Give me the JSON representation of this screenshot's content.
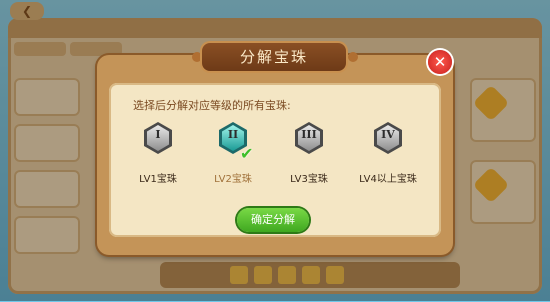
{
  "dialog": {
    "title": "分解宝珠",
    "prompt": "选择后分解对应等级的所有宝珠:",
    "close_glyph": "✕",
    "confirm_label": "确定分解"
  },
  "gems": [
    {
      "numeral": "I",
      "label": "LV1宝珠",
      "selected": false
    },
    {
      "numeral": "II",
      "label": "LV2宝珠",
      "selected": true
    },
    {
      "numeral": "III",
      "label": "LV3宝珠",
      "selected": false
    },
    {
      "numeral": "IV",
      "label": "LV4以上宝珠",
      "selected": false
    }
  ],
  "check_glyph": "✔",
  "back_glyph": "❮",
  "colors": {
    "selected_gem": "#1a9a95",
    "confirm_button": "#3fa820",
    "close_button": "#c81e1e",
    "title_bar": "#6e3a17"
  }
}
